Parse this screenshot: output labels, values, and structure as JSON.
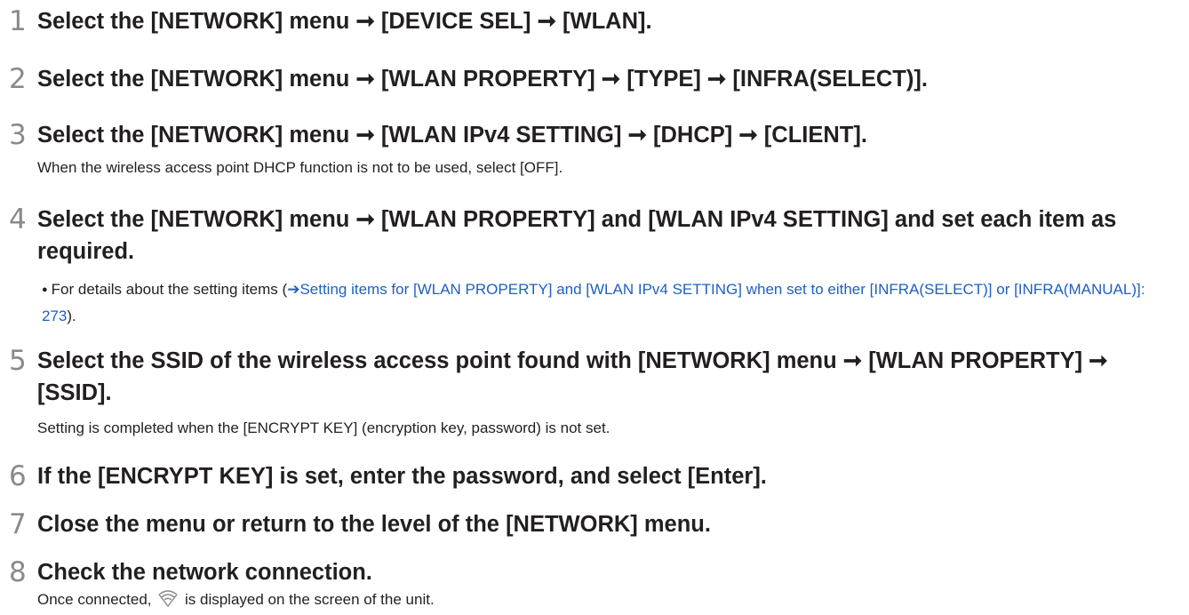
{
  "steps": [
    {
      "num": "1",
      "head": "Select the [NETWORK] menu ➞ [DEVICE SEL] ➞ [WLAN]."
    },
    {
      "num": "2",
      "head": "Select the [NETWORK] menu ➞ [WLAN PROPERTY] ➞ [TYPE] ➞ [INFRA(SELECT)]."
    },
    {
      "num": "3",
      "head": "Select the [NETWORK] menu ➞ [WLAN IPv4 SETTING] ➞ [DHCP] ➞ [CLIENT].",
      "body": "When the wireless access point DHCP function is not to be used, select [OFF]."
    },
    {
      "num": "4",
      "head": "Select the [NETWORK] menu ➞ [WLAN PROPERTY] and [WLAN IPv4 SETTING] and set each item as required.",
      "bullet_prefix": "For details about the setting items (",
      "link_arrow": "➔",
      "link_text": "Setting items for [WLAN PROPERTY] and [WLAN IPv4 SETTING] when set to either [INFRA(SELECT)] or [INFRA(MANUAL)]: 273",
      "bullet_suffix": ")."
    },
    {
      "num": "5",
      "head": "Select the SSID of the wireless access point found with [NETWORK] menu ➞ [WLAN PROPERTY] ➞ [SSID].",
      "body": "Setting is completed when the [ENCRYPT KEY] (encryption key, password) is not set."
    },
    {
      "num": "6",
      "head": "If the [ENCRYPT KEY] is set, enter the password, and select [Enter]."
    },
    {
      "num": "7",
      "head": "Close the menu or return to the level of the [NETWORK] menu."
    },
    {
      "num": "8",
      "head": "Check the network connection.",
      "body_before_icon": "Once connected,",
      "icon": "wifi-icon",
      "body_after_icon": "is displayed on the screen of the unit."
    }
  ]
}
